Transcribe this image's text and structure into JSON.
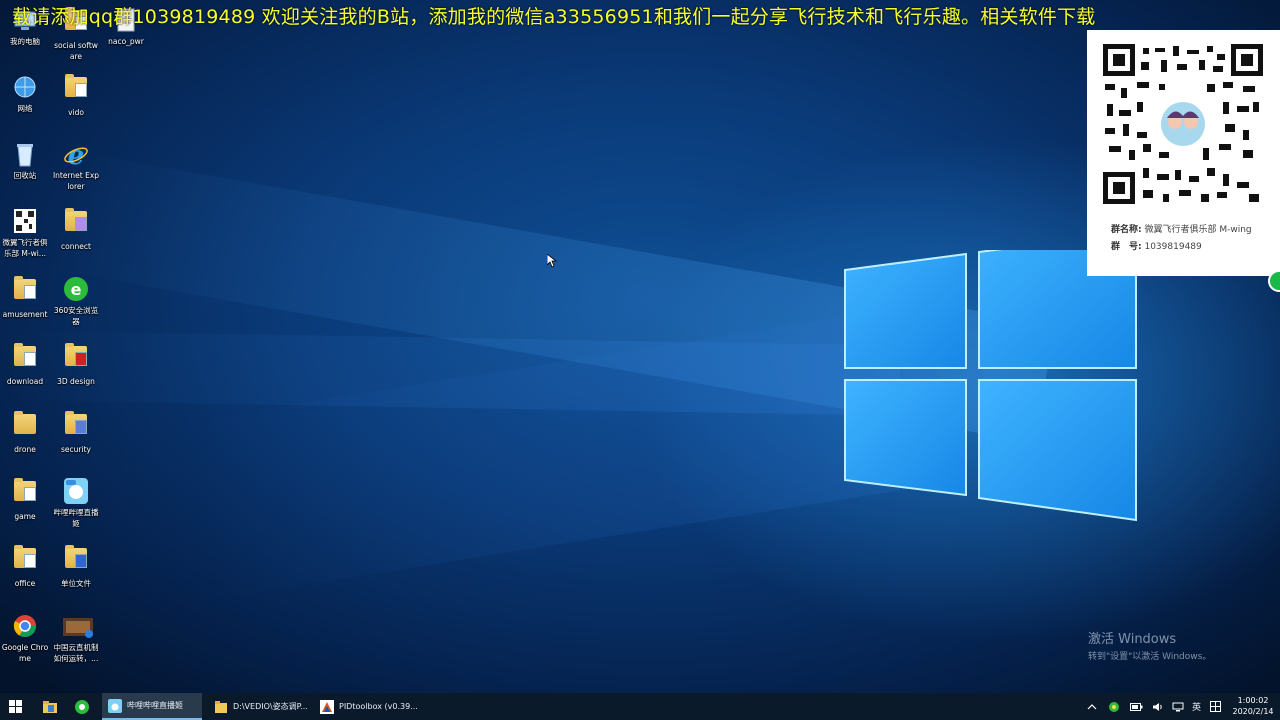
{
  "banner_text": "载请添加qq群1039819489  欢迎关注我的B站，添加我的微信a33556951和我们一起分享飞行技术和飞行乐趣。相关软件下载",
  "desktop_icons": [
    {
      "label": "我的电脑",
      "icon": "computer-icon"
    },
    {
      "label": "social software",
      "icon": "folder-icon"
    },
    {
      "label": "naco_pwr",
      "icon": "file-icon"
    },
    {
      "label": "网络",
      "icon": "network-icon"
    },
    {
      "label": "vido",
      "icon": "folder-icon"
    },
    {
      "label": "回收站",
      "icon": "recycle-bin-icon"
    },
    {
      "label": "Internet Explorer",
      "icon": "ie-icon"
    },
    {
      "label": "微翼飞行者俱乐部 M-wi...",
      "icon": "qr-image-icon"
    },
    {
      "label": "connect",
      "icon": "folder-icon"
    },
    {
      "label": "amusement",
      "icon": "folder-icon"
    },
    {
      "label": "360安全浏览器",
      "icon": "360-browser-icon"
    },
    {
      "label": "download",
      "icon": "folder-icon"
    },
    {
      "label": "3D design",
      "icon": "folder-icon"
    },
    {
      "label": "drone",
      "icon": "folder-icon"
    },
    {
      "label": "security",
      "icon": "folder-icon"
    },
    {
      "label": "game",
      "icon": "folder-icon"
    },
    {
      "label": "哔哩哔哩直播姬",
      "icon": "bilibili-live-icon"
    },
    {
      "label": "office",
      "icon": "folder-icon"
    },
    {
      "label": "单位文件",
      "icon": "folder-icon"
    },
    {
      "label": "Google Chrome",
      "icon": "chrome-icon"
    },
    {
      "label": "中国云直机制如何运转，...",
      "icon": "video-thumbnail-icon"
    }
  ],
  "qr_panel": {
    "group_name_label": "群名称:",
    "group_name_value": "微翼飞行者俱乐部 M-wing",
    "group_number_label": "群　号:",
    "group_number_value": "1039819489"
  },
  "watermark": {
    "line1": "激活 Windows",
    "line2": "转到\"设置\"以激活 Windows。"
  },
  "taskbar": {
    "tasks": [
      {
        "label": "哔哩哔哩直播姬",
        "icon": "bilibili-live-icon",
        "active": true
      },
      {
        "label": "D:\\VEDIO\\姿态调P...",
        "icon": "folder-icon",
        "active": false
      },
      {
        "label": "PIDtoolbox (v0.39...",
        "icon": "pidtoolbox-icon",
        "active": false
      }
    ],
    "tray": {
      "ime": "英",
      "time": "1:00:02",
      "date": "2020/2/14"
    }
  },
  "colors": {
    "banner": "#f7ff2a",
    "taskbar": "#0b1a2b",
    "desktop_blue": "#0e4f95"
  }
}
